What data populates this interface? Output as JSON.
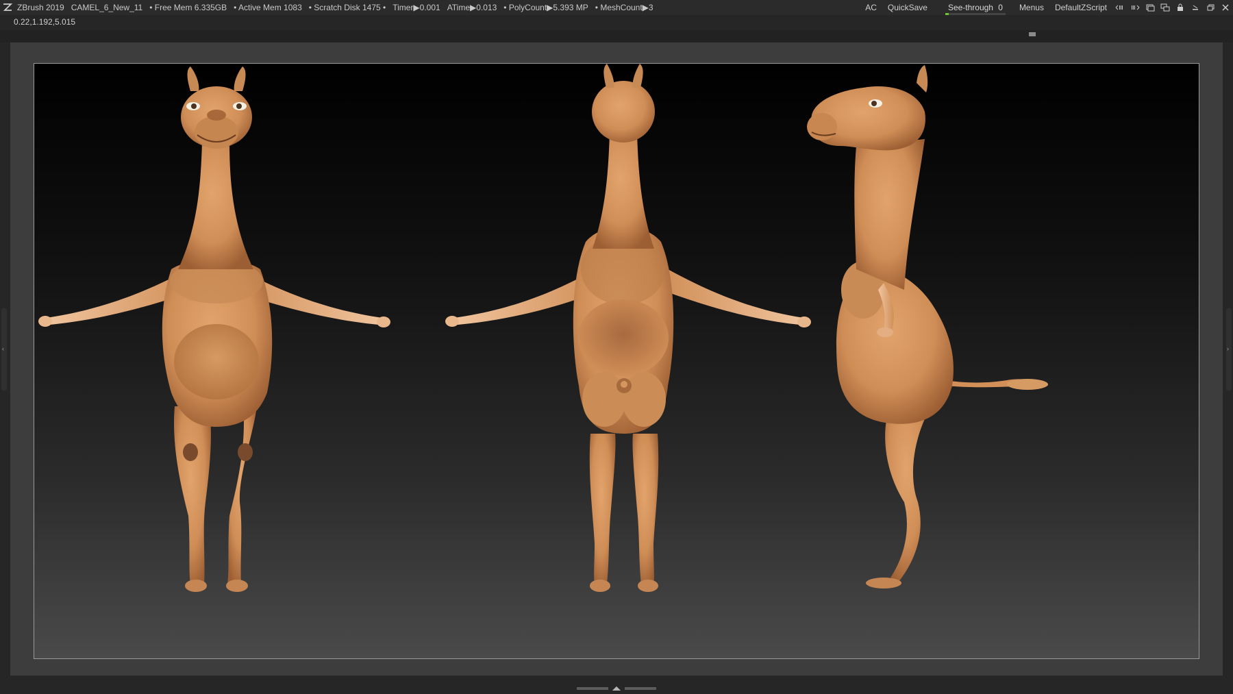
{
  "titlebar": {
    "app_name": "ZBrush 2019",
    "project": "CAMEL_6_New_11",
    "free_mem": "• Free Mem 6.335GB",
    "active_mem": "• Active Mem 1083",
    "scratch_disk": "• Scratch Disk 1475 •",
    "timer": "Timer▶0.001",
    "atime": "ATime▶0.013",
    "polycount": "• PolyCount▶5.393 MP",
    "meshcount": "• MeshCount▶3",
    "ac_label": "AC",
    "quicksave_label": "QuickSave",
    "seethrough_label": "See-through",
    "seethrough_value": "0",
    "seethrough_level": 0.06,
    "menus_label": "Menus",
    "script_label": "DefaultZScript"
  },
  "coords": "0.22,1.192,5.015",
  "colors": {
    "skin": "#d4955f",
    "skin_dark": "#a8683a",
    "skin_light": "#efc49a",
    "frame": "#3d3d3d",
    "accent": "#6ec630"
  },
  "icons": {
    "app": "zbrush-logo-icon",
    "window": [
      "layout-left-icon",
      "layout-right-icon",
      "interface-icon-1",
      "interface-icon-2",
      "lock-icon",
      "minimize-icon",
      "restore-icon",
      "close-icon"
    ]
  }
}
